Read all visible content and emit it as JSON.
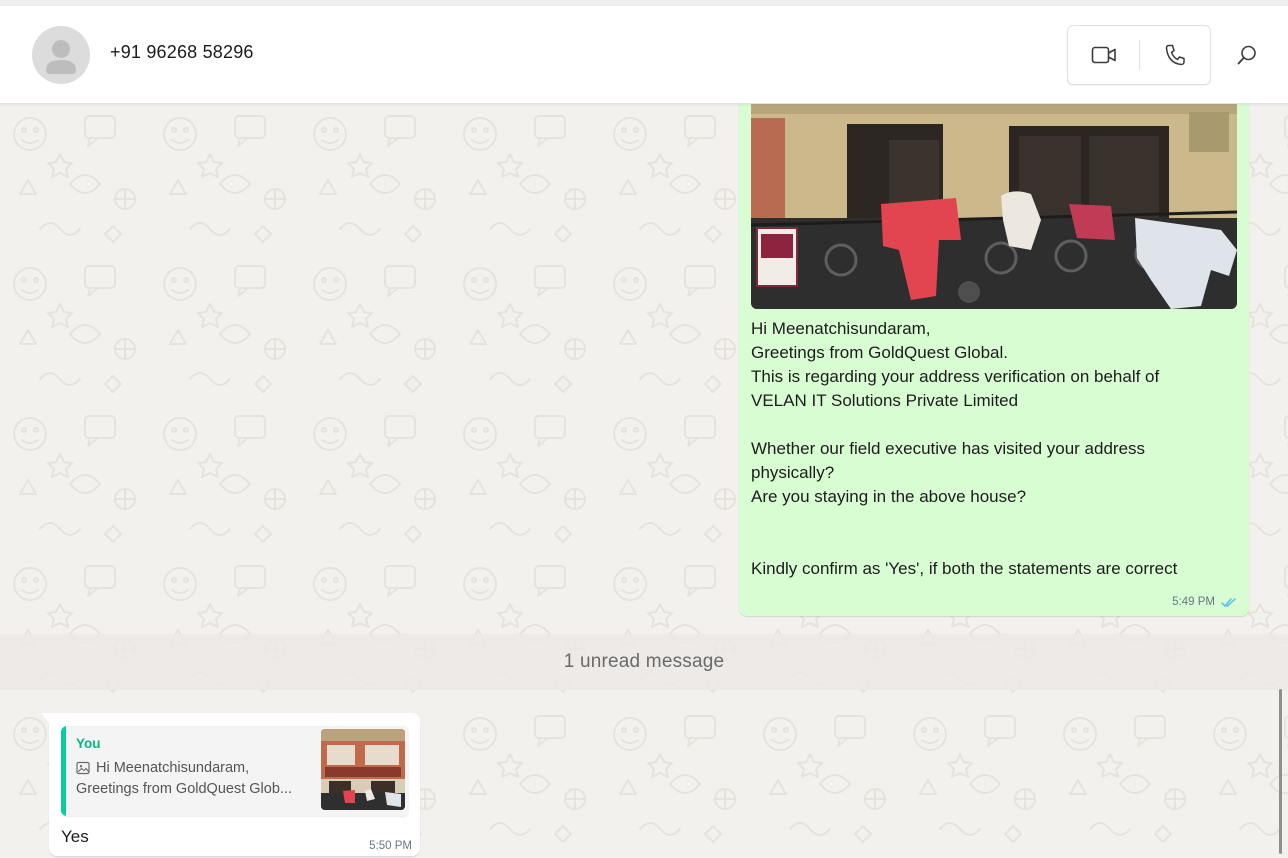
{
  "header": {
    "contact_name": "+91 96268 58296"
  },
  "outgoing_message": {
    "lines": [
      "Hi Meenatchisundaram,",
      "Greetings from GoldQuest Global.",
      "This is regarding your address verification on behalf of",
      "VELAN IT Solutions Private Limited",
      "",
      "Whether our field executive has visited your address",
      "physically?",
      "Are you staying in the above house?",
      "",
      "",
      "Kindly confirm as 'Yes', if both the statements are correct"
    ],
    "time": "5:49 PM",
    "status": "read",
    "status_color": "#53bdeb"
  },
  "divider": {
    "text": "1 unread message"
  },
  "incoming_reply": {
    "quote_author": "You",
    "quote_line1": "Hi Meenatchisundaram,",
    "quote_line2": "Greetings from GoldQuest Glob...",
    "text": "Yes",
    "time": "5:50 PM"
  },
  "colors": {
    "outgoing_bubble": "#d9fdd3",
    "quote_accent": "#06cf9c",
    "wallpaper": "#f3f1ee"
  }
}
